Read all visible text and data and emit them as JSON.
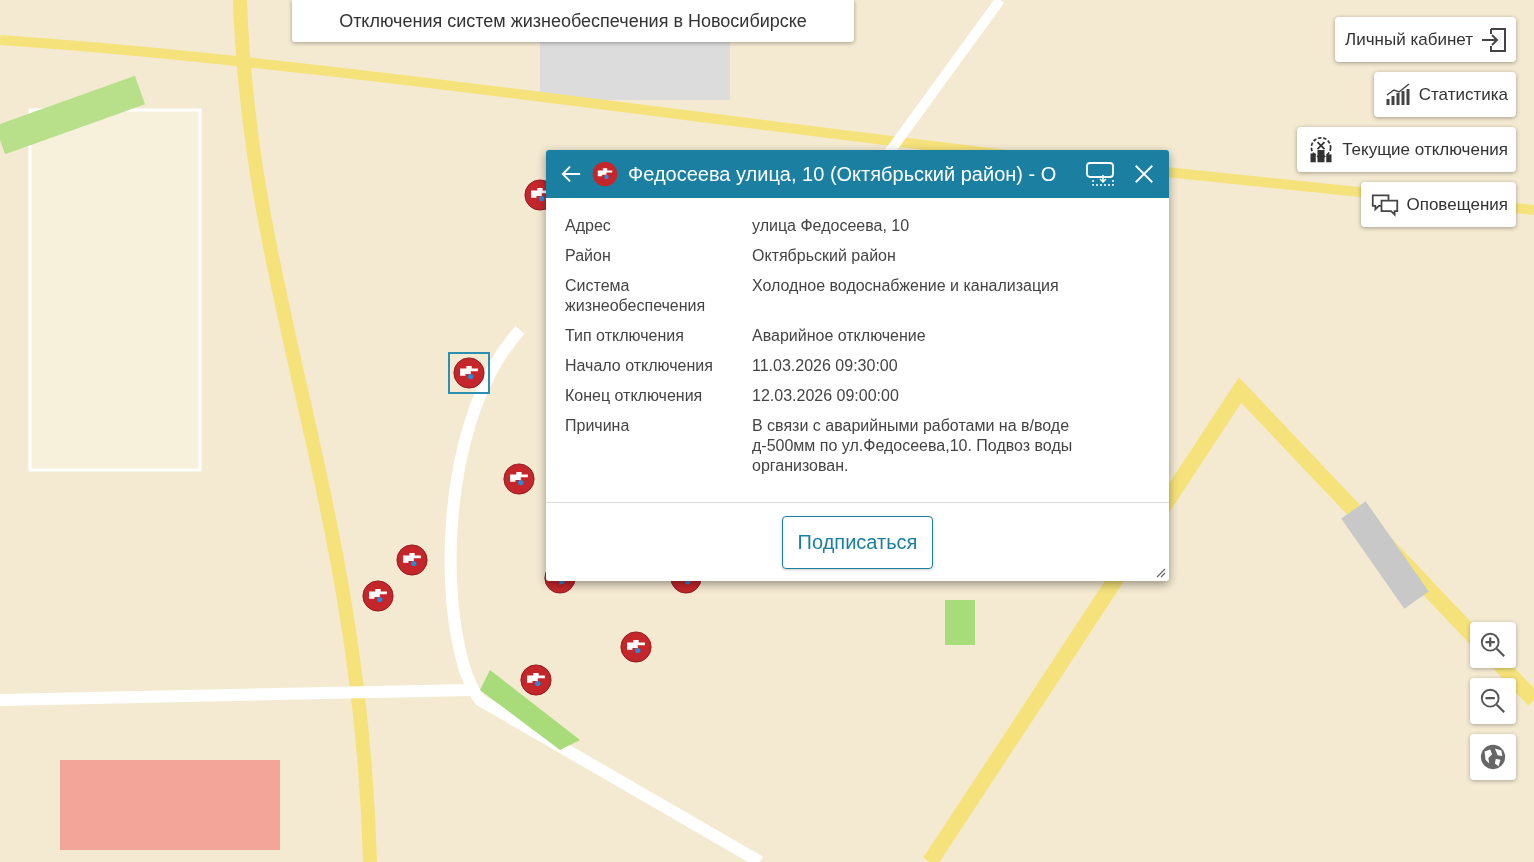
{
  "page_title": "Отключения систем жизнеобеспечения в Новосибирске",
  "nav_buttons": [
    {
      "label": "Личный кабинет",
      "kind": "login"
    },
    {
      "label": "Статистика",
      "kind": "stats"
    },
    {
      "label": "Текущие отключения",
      "kind": "outages"
    },
    {
      "label": "Оповещения",
      "kind": "alerts"
    }
  ],
  "markers": [
    {
      "selected": false
    },
    {
      "selected": true
    },
    {
      "selected": false
    },
    {
      "selected": false
    },
    {
      "selected": false
    },
    {
      "selected": false
    },
    {
      "selected": false
    },
    {
      "selected": false
    },
    {
      "selected": false
    }
  ],
  "popup": {
    "title": "Федосеева улица, 10 (Октябрьский район) - О",
    "fields": [
      {
        "label": "Адрес",
        "value": "улица Федосеева, 10"
      },
      {
        "label": "Район",
        "value": "Октябрьский район"
      },
      {
        "label": "Система жизнеобеспечения",
        "value": "Холодное водоснабжение и канализация"
      },
      {
        "label": "Тип отключения",
        "value": "Аварийное отключение"
      },
      {
        "label": "Начало отключения",
        "value": "11.03.2026 09:30:00"
      },
      {
        "label": "Конец отключения",
        "value": "12.03.2026 09:00:00"
      },
      {
        "label": "Причина",
        "value": "В связи с аварийными работами на в/воде д-500мм по ул.Федосеева,10. Подвоз воды организован."
      }
    ],
    "subscribe_button": "Подписаться"
  }
}
